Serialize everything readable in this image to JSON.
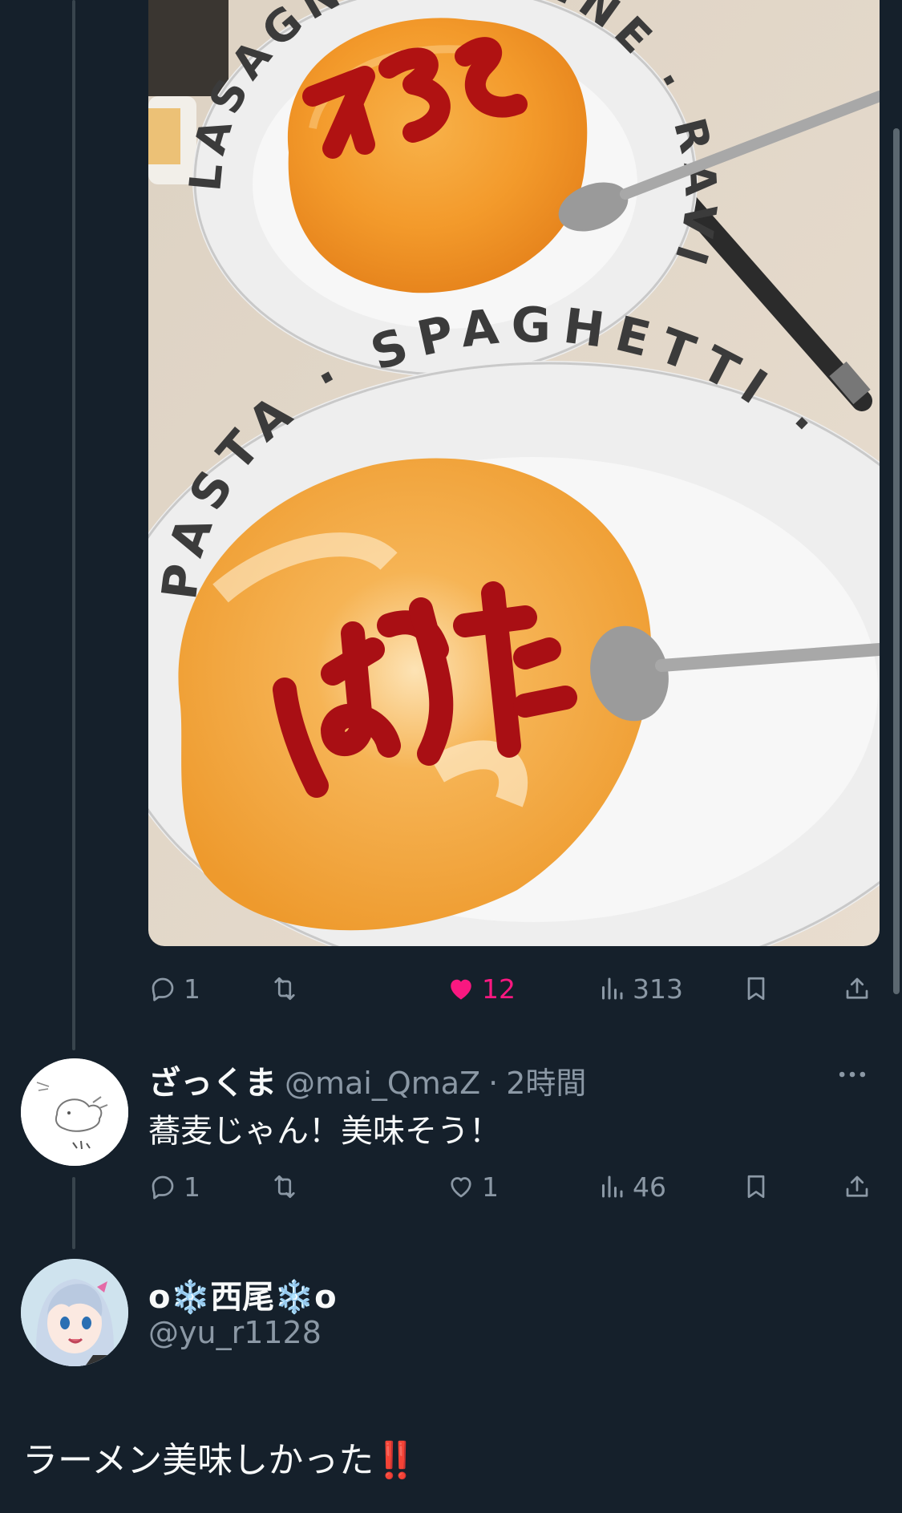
{
  "post1": {
    "actions": {
      "replies": "1",
      "retweets": "",
      "likes": "12",
      "views": "313"
    }
  },
  "reply1": {
    "display_name": "ざっくま",
    "handle": "@mai_QmaZ",
    "separator": "·",
    "time": "2時間",
    "text": "蕎麦じゃん！美味そう！",
    "actions": {
      "replies": "1",
      "retweets": "",
      "likes": "1",
      "views": "46"
    }
  },
  "reply2": {
    "display_name": "o❄️西尾❄️o",
    "handle": "@yu_r1128",
    "text": "ラーメン美味しかった‼️"
  },
  "photo_text": {
    "plate1_rim": "LASAGNA · PENNE · RAVIOLI · PASTA · SPAGHETTI ·",
    "plate2_rim": "PASTA · SPAGHETTI · LASAGNA · RAVIOLI ·",
    "ketchup1": "そば",
    "ketchup2": "ぼうず"
  },
  "colors": {
    "background": "#15202b",
    "muted": "#8b98a5",
    "like_active": "#f91880",
    "thread_line": "#38444d"
  },
  "icons": [
    "reply-icon",
    "retweet-icon",
    "like-icon",
    "views-icon",
    "bookmark-icon",
    "share-icon",
    "more-icon"
  ]
}
